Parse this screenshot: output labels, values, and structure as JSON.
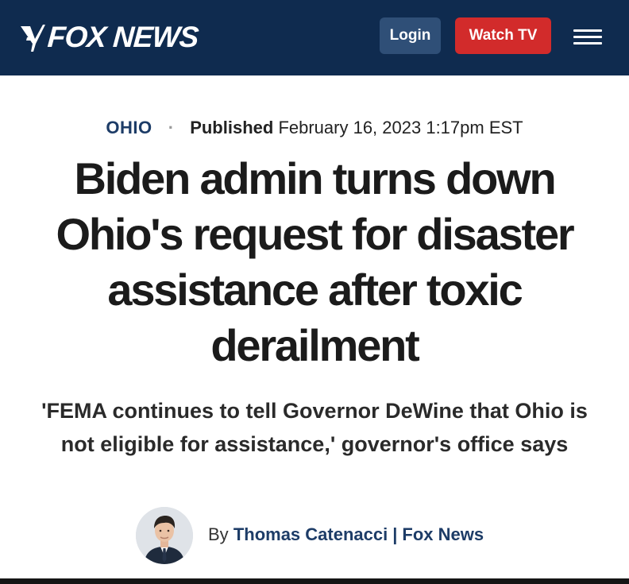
{
  "header": {
    "logo_text": "FOX NEWS",
    "login_label": "Login",
    "watch_label": "Watch TV",
    "menu_icon": "hamburger-menu-icon"
  },
  "article": {
    "section": "OHIO",
    "published_label": "Published",
    "published_date": "February 16, 2023 1:17pm EST",
    "headline": "Biden admin turns down Ohio's request for disaster assistance after toxic derailment",
    "subheadline": "'FEMA continues to tell Governor DeWine that Ohio is not eligible for assistance,' governor's office says",
    "byline_prefix": "By",
    "author": "Thomas Catenacci",
    "separator": "|",
    "organization": "Fox News"
  },
  "colors": {
    "header_bg": "#0f2b4f",
    "login_bg": "#2f4f77",
    "watch_bg": "#d22b2b",
    "link_blue": "#1d3c67"
  }
}
